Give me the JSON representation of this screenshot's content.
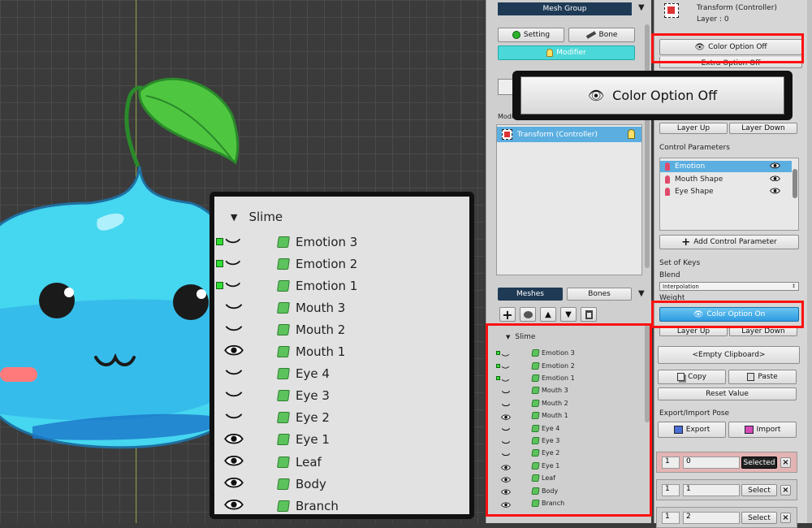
{
  "mesh_group": {
    "dropdown_label": "Mesh Group",
    "setting_label": "Setting",
    "bone_label": "Bone",
    "modifier_label": "Modifier",
    "stack_label": "Modifier Stack",
    "stack_item": "Transform (Controller)"
  },
  "meshes_tabs": {
    "meshes": "Meshes",
    "bones": "Bones"
  },
  "header": {
    "title": "Transform (Controller)",
    "layer": "Layer : 0"
  },
  "buttons": {
    "color_option_off": "Color Option Off",
    "extra_option_off": "Extra Option Off",
    "color_option_on": "Color Option On",
    "layer_up": "Layer Up",
    "layer_down": "Layer Down",
    "add_control_parameter": "Add Control Parameter",
    "empty_clipboard": "<Empty Clipboard>",
    "copy": "Copy",
    "paste": "Paste",
    "reset_value": "Reset Value",
    "export": "Export",
    "import": "Import"
  },
  "labels": {
    "control_parameters": "Control Parameters",
    "set_of_keys": "Set of Keys",
    "blend": "Blend",
    "blend_value": "Interpolation",
    "weight": "Weight",
    "export_import_pose": "Export/Import Pose"
  },
  "control_parameters": [
    "Emotion",
    "Mouth Shape",
    "Eye Shape"
  ],
  "keys": [
    {
      "index": "1",
      "value": "0",
      "button": "Selected"
    },
    {
      "index": "1",
      "value": "1",
      "button": "Select"
    },
    {
      "index": "1",
      "value": "2",
      "button": "Select"
    }
  ],
  "callout": {
    "label": "Color Option Off"
  },
  "tree": {
    "root": "Slime",
    "items": [
      {
        "name": "Emotion 3",
        "vis": "key"
      },
      {
        "name": "Emotion 2",
        "vis": "key"
      },
      {
        "name": "Emotion 1",
        "vis": "key"
      },
      {
        "name": "Mouth 3",
        "vis": "closed"
      },
      {
        "name": "Mouth 2",
        "vis": "closed"
      },
      {
        "name": "Mouth 1",
        "vis": "open"
      },
      {
        "name": "Eye 4",
        "vis": "closed"
      },
      {
        "name": "Eye 3",
        "vis": "closed"
      },
      {
        "name": "Eye 2",
        "vis": "closed"
      },
      {
        "name": "Eye 1",
        "vis": "open"
      },
      {
        "name": "Leaf",
        "vis": "open"
      },
      {
        "name": "Body",
        "vis": "open"
      },
      {
        "name": "Branch",
        "vis": "open"
      }
    ]
  },
  "colors": {
    "accent": "#4ad8d8",
    "selection": "#5aaee0",
    "highlight": "#ff1010"
  }
}
